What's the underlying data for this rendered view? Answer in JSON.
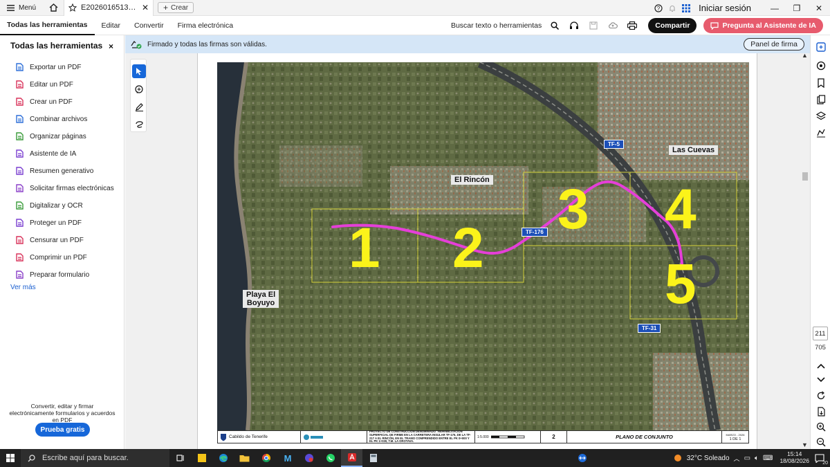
{
  "titlebar": {
    "menu_label": "Menú",
    "tab_title": "E2026016513_Proy...",
    "create_label": "Crear",
    "signin_label": "Iniciar sesión"
  },
  "menubar": {
    "items": [
      "Todas las herramientas",
      "Editar",
      "Convertir",
      "Firma electrónica"
    ],
    "active_item": "Todas las herramientas",
    "search_label": "Buscar texto o herramientas",
    "share_label": "Compartir",
    "ai_label": "Pregunta al Asistente de IA"
  },
  "left_panel": {
    "title": "Todas las herramientas",
    "close_symbol": "×",
    "tools": [
      {
        "label": "Exportar un PDF",
        "icon": "export-pdf-icon",
        "color": "#2d6fd8"
      },
      {
        "label": "Editar un PDF",
        "icon": "edit-pdf-icon",
        "color": "#d8325a"
      },
      {
        "label": "Crear un PDF",
        "icon": "create-pdf-icon",
        "color": "#d8325a"
      },
      {
        "label": "Combinar archivos",
        "icon": "combine-files-icon",
        "color": "#2d6fd8"
      },
      {
        "label": "Organizar páginas",
        "icon": "organize-pages-icon",
        "color": "#3a9b3a"
      },
      {
        "label": "Asistente de IA",
        "icon": "ai-assistant-icon",
        "color": "#7a3fd0"
      },
      {
        "label": "Resumen generativo",
        "icon": "generative-summary-icon",
        "color": "#7a3fd0"
      },
      {
        "label": "Solicitar firmas electrónicas",
        "icon": "request-signatures-icon",
        "color": "#8a3fc8"
      },
      {
        "label": "Digitalizar y OCR",
        "icon": "scan-ocr-icon",
        "color": "#3a9b3a"
      },
      {
        "label": "Proteger un PDF",
        "icon": "protect-pdf-icon",
        "color": "#7a3fd0"
      },
      {
        "label": "Censurar un PDF",
        "icon": "redact-pdf-icon",
        "color": "#d8325a"
      },
      {
        "label": "Comprimir un PDF",
        "icon": "compress-pdf-icon",
        "color": "#d8325a"
      },
      {
        "label": "Preparar formulario",
        "icon": "prepare-form-icon",
        "color": "#8a3fc8"
      }
    ],
    "see_more": "Ver más",
    "promo_text": "Convertir, editar y firmar electrónicamente formularios y acuerdos en PDF",
    "trial_label": "Prueba gratis"
  },
  "signature_bar": {
    "message": "Firmado y todas las firmas son válidas.",
    "panel_button": "Panel de firma"
  },
  "map": {
    "place_labels": {
      "el_rincon": "El Rincón",
      "las_cuevas": "Las Cuevas",
      "playa": "Playa El\nBoyuyo"
    },
    "roads": {
      "tf5": "TF-5",
      "tf176": "TF-176",
      "tf31": "TF-31"
    },
    "sectors": [
      "1",
      "2",
      "3",
      "4",
      "5"
    ]
  },
  "title_block": {
    "cabildo": "Cabildo de Tenerife",
    "project": "PROYECTO DE CONSTRUCCIÓN DENOMINADO \"REHABILITACIÓN SUPERFICIAL DE FIRME EN LA CARRETERA INSULAR TF-176, DE LA TF-217 A EL RINCÓN, EN EL TRAMO COMPRENDIDO ENTRE EL PK 0+000 Y EL PK 1+030, T.M. LA OROTAVA.",
    "scale": "1:5.000",
    "plan_number": "2",
    "plan_title": "PLANO DE CONJUNTO",
    "date": "MARZO - 2026",
    "sheet": "1  DE  1"
  },
  "right_rail": {
    "page_number": "211",
    "page_total": "705"
  },
  "taskbar": {
    "search_placeholder": "Escribe aquí para buscar.",
    "weather": "32°C Soleado",
    "time": "15:14",
    "date": "18/08/2026",
    "notification_count": "20"
  }
}
